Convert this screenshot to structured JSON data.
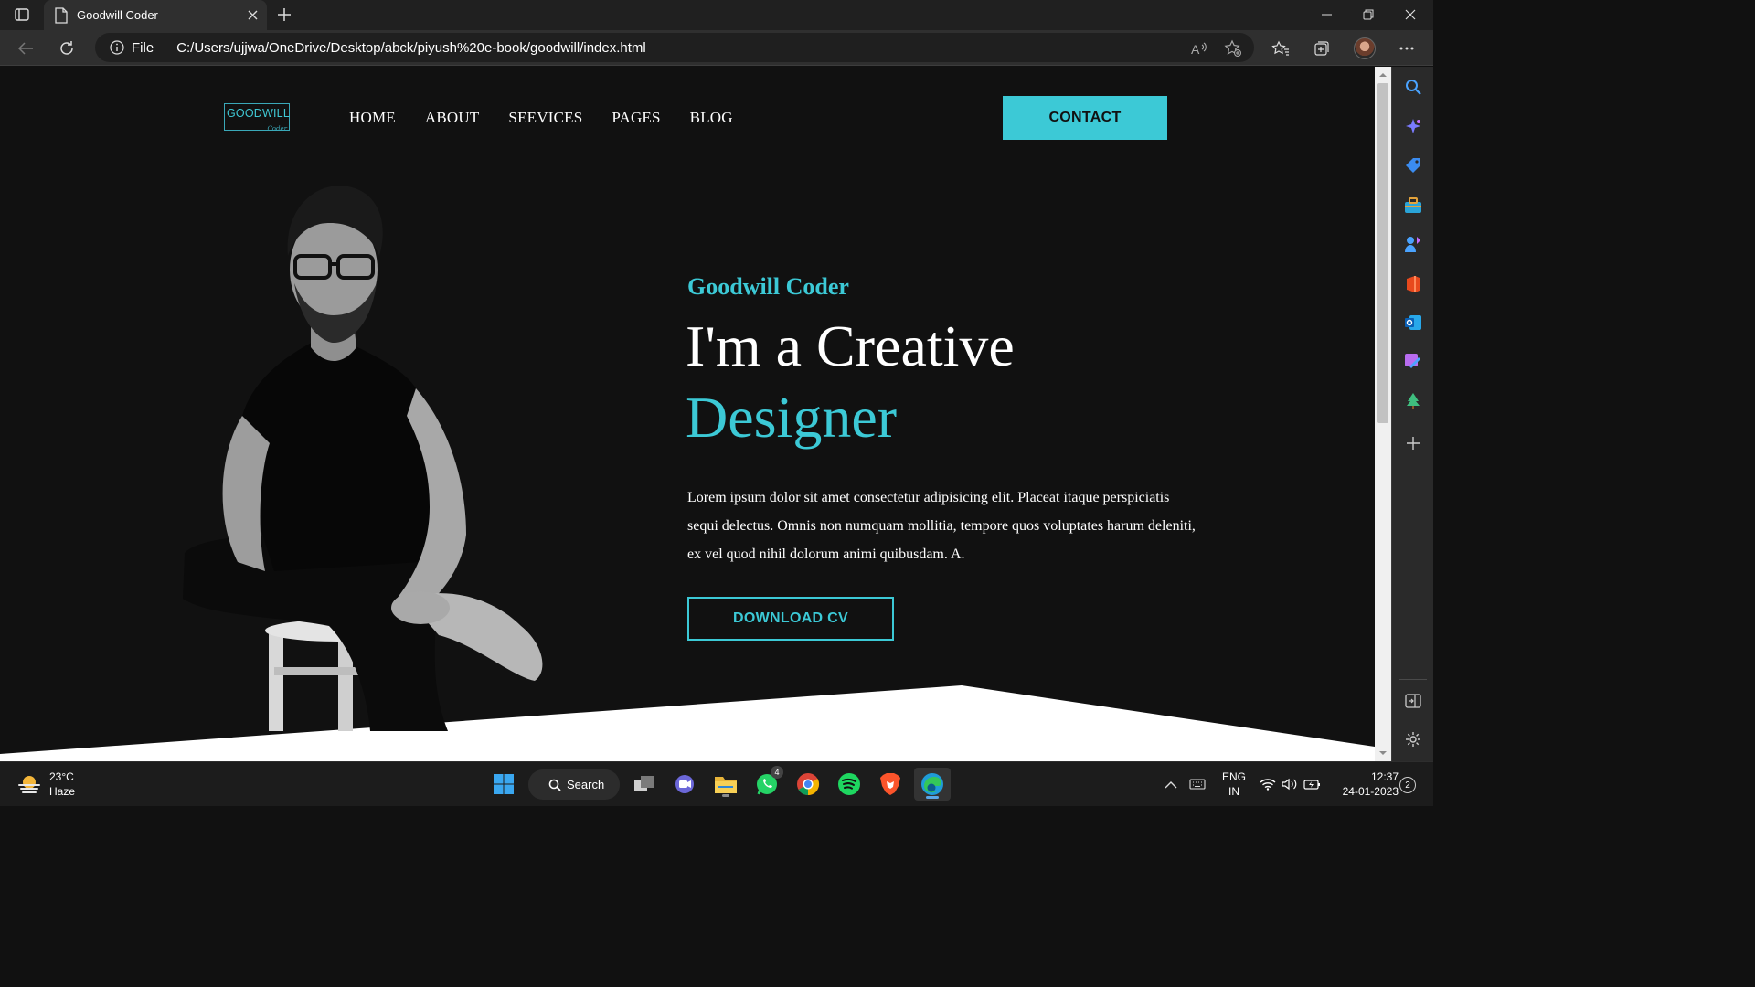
{
  "browser": {
    "tab_title": "Goodwill Coder",
    "file_label": "File",
    "url": "C:/Users/ujjwa/OneDrive/Desktop/abck/piyush%20e-book/goodwill/index.html"
  },
  "site": {
    "logo_text": "GOODWILL",
    "logo_sub": "Coder",
    "nav": [
      "HOME",
      "ABOUT",
      "SEEVICES",
      "PAGES",
      "BLOG"
    ],
    "contact_label": "CONTACT",
    "accent": "#3cc9d6",
    "background": "#111111",
    "hero": {
      "name": "Goodwill Coder",
      "line1": "I'm a Creative",
      "line2": "Designer",
      "paragraph": "Lorem ipsum dolor sit amet consectetur adipisicing elit. Placeat itaque perspiciatis sequi delectus. Omnis non numquam mollitia, tempore quos voluptates harum deleniti, ex vel quod nihil dolorum animi quibusdam. A.",
      "cta_label": "DOWNLOAD CV"
    }
  },
  "sidebar_icons": [
    "search-icon",
    "copilot-icon",
    "shopping-icon",
    "tools-icon",
    "games-icon",
    "office-icon",
    "outlook-icon",
    "designer-icon",
    "tree-icon",
    "add-icon",
    "split-screen-icon",
    "settings-icon"
  ],
  "taskbar": {
    "weather_temp": "23°C",
    "weather_desc": "Haze",
    "search_label": "Search",
    "whatsapp_badge": "4",
    "lang": "ENG",
    "region": "IN",
    "time": "12:37",
    "date": "24-01-2023",
    "notifications": "2"
  }
}
